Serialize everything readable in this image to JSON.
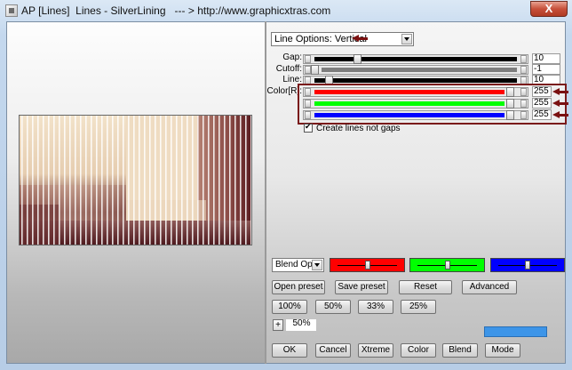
{
  "window": {
    "title": "AP [Lines]  Lines - SilverLining   --- > http://www.graphicxtras.com",
    "close_glyph": "X"
  },
  "line_options": {
    "value": "Line Options: Vertical"
  },
  "controls": [
    {
      "label": "Gap:",
      "value": "10",
      "track": "black"
    },
    {
      "label": "Cutoff:",
      "value": "-1",
      "track": "gray"
    },
    {
      "label": "Line:",
      "value": "10",
      "track": "black"
    },
    {
      "label": "Color[R]:",
      "value": "255",
      "track": "#ff0000"
    },
    {
      "label": "",
      "value": "255",
      "track": "#00ff00"
    },
    {
      "label": "",
      "value": "255",
      "track": "#0000ff"
    }
  ],
  "create_lines": {
    "label": "Create lines not gaps",
    "checked": true
  },
  "blend": {
    "value": "Blend Optio"
  },
  "color_sliders": [
    {
      "color": "#ff0000",
      "level": 0.5
    },
    {
      "color": "#00ff00",
      "level": 0.5
    },
    {
      "color": "#0000ff",
      "level": 0.5
    }
  ],
  "buttons": {
    "open_preset": "Open preset",
    "save_preset": "Save preset",
    "reset": "Reset",
    "advanced": "Advanced",
    "z100": "100%",
    "z50": "50%",
    "z33": "33%",
    "z25": "25%",
    "ok": "OK",
    "cancel": "Cancel",
    "xtreme": "Xtreme",
    "color": "Color",
    "blend": "Blend",
    "mode": "Mode"
  },
  "zoom": {
    "plus": "+",
    "value": "50%"
  },
  "colors": {
    "accent_blue": "#3d95e8",
    "highlight": "#7a1a1a"
  }
}
